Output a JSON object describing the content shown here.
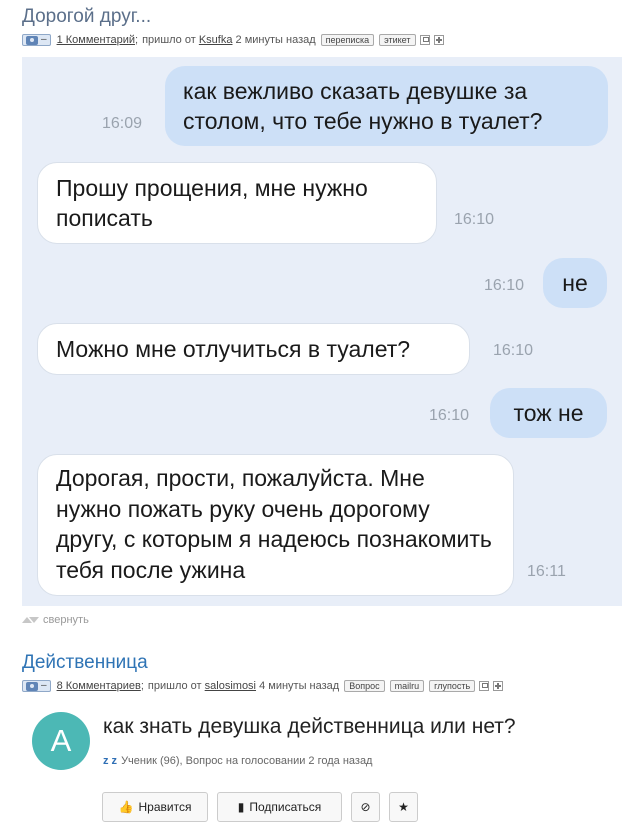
{
  "post1": {
    "title": "Дорогой друг...",
    "camera_dash": "–",
    "comments": "1 Комментарий",
    "sep": ";",
    "arrived": "пришло от",
    "author": "Ksufka",
    "time_ago": "2 минуты назад",
    "tags": [
      "переписка",
      "этикет"
    ]
  },
  "chat": {
    "messages": [
      {
        "dir": "out",
        "text": "как вежливо сказать девушке за столом, что тебе нужно в туалет?",
        "time": "16:09"
      },
      {
        "dir": "in",
        "text": "Прошу прощения, мне нужно пописать",
        "time": "16:10"
      },
      {
        "dir": "out",
        "text": "не",
        "time": "16:10"
      },
      {
        "dir": "in",
        "text": "Можно мне отлучиться в туалет?",
        "time": "16:10"
      },
      {
        "dir": "out",
        "text": "тож не",
        "time": "16:10"
      },
      {
        "dir": "in",
        "text": "Дорогая, прости, пожалуйста. Мне нужно пожать руку очень дорогому другу, с которым я надеюсь познакомить тебя после ужина",
        "time": "16:11"
      }
    ]
  },
  "collapse_label": "свернуть",
  "post2": {
    "title": "Действенница",
    "camera_dash": "–",
    "comments": "8 Комментариев",
    "sep": ";",
    "arrived": "пришло от",
    "author": "salosimosi",
    "time_ago": "4 минуты назад",
    "tags": [
      "Вопрос",
      "mailru",
      "глупость"
    ]
  },
  "question": {
    "avatar_letter": "A",
    "title": "как знать девушка действенница или нет?",
    "user": "z z",
    "meta": "Ученик (96), Вопрос на голосовании 2 года назад",
    "like_label": "Нравится",
    "subscribe_label": "Подписаться"
  },
  "colors": {
    "chat_bg": "#e8eef8",
    "out_bubble": "#cde0f7",
    "in_bubble": "#ffffff",
    "avatar": "#4cb8b5",
    "link_blue": "#2f74b5"
  },
  "icons": [
    "camera-icon",
    "save-icon",
    "plus-icon",
    "collapse-arrows-icon",
    "thumbs-up-icon",
    "bookmark-icon",
    "block-icon",
    "star-icon"
  ]
}
